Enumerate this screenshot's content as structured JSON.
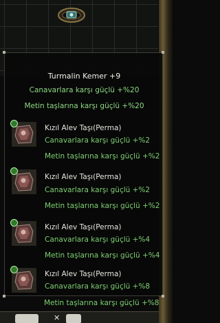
{
  "tooltip": {
    "title": "Turmalin Kemer +9",
    "bonuses": [
      "Canavarlara karşı güçlü +%20",
      "Metin taşlarına karşı güçlü +%20"
    ],
    "stones": [
      {
        "name": "Kızıl Alev Taşı(Perma)",
        "bonus1": "Canavarlara karşı güçlü +%2",
        "bonus2": "Metin taşlarına karşı güçlü +%2"
      },
      {
        "name": "Kızıl Alev Taşı(Perma)",
        "bonus1": "Canavarlara karşı güçlü +%2",
        "bonus2": "Metin taşlarına karşı güçlü +%2"
      },
      {
        "name": "Kızıl Alev Taşı(Perma)",
        "bonus1": "Canavarlara karşı güçlü +%4",
        "bonus2": "Metin taşlarına karşı güçlü +%4"
      },
      {
        "name": "Kızıl Alev Taşı(Perma)",
        "bonus1": "Canavarlara karşı güçlü +%8",
        "bonus2": "Metin taşlarına karşı güçlü +%8"
      }
    ]
  },
  "icons": {
    "belt": "belt-icon",
    "stone": "red-stone-icon",
    "socket": "socket-badge-icon"
  },
  "colors": {
    "title": "#f2f2ea",
    "bonus_green": "#8fd884",
    "tooltip_bg": "#080908"
  }
}
